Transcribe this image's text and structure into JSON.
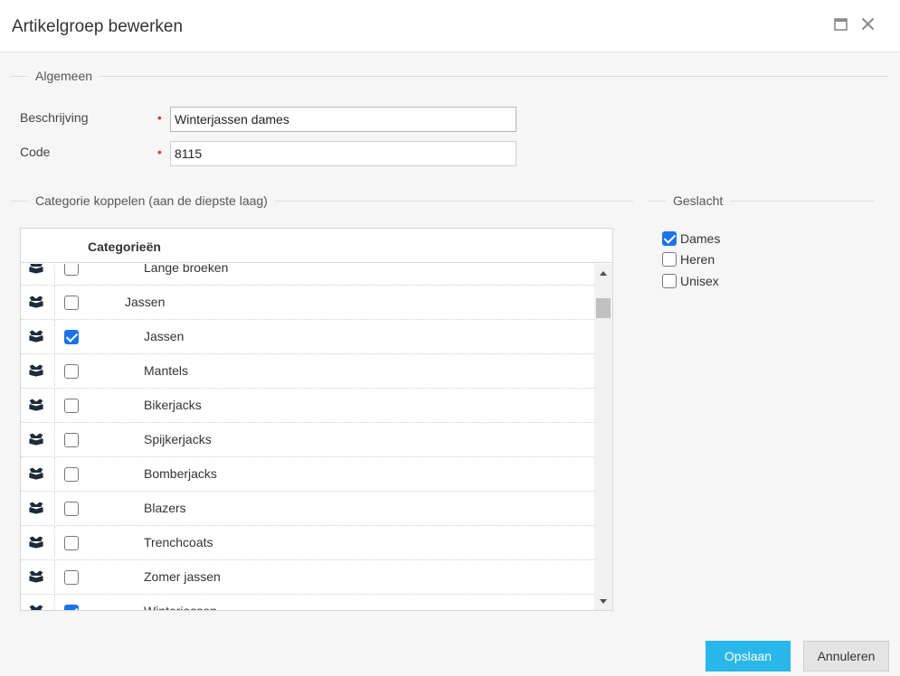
{
  "dialog": {
    "title": "Artikelgroep bewerken",
    "maximize_icon": "maximize-icon",
    "close_icon": "close-icon"
  },
  "general": {
    "legend": "Algemeen",
    "description_label": "Beschrijving",
    "description_value": "Winterjassen dames",
    "code_label": "Code",
    "code_value": "8115",
    "required_marker": "•"
  },
  "category": {
    "legend": "Categorie koppelen (aan de diepste laag)",
    "column_header": "Categorieën",
    "row_icon": "package-icon",
    "rows": [
      {
        "label": "Lange broeken",
        "level": 2,
        "checked": false
      },
      {
        "label": "Jassen",
        "level": 1,
        "checked": false
      },
      {
        "label": "Jassen",
        "level": 2,
        "checked": true
      },
      {
        "label": "Mantels",
        "level": 2,
        "checked": false
      },
      {
        "label": "Bikerjacks",
        "level": 2,
        "checked": false
      },
      {
        "label": "Spijkerjacks",
        "level": 2,
        "checked": false
      },
      {
        "label": "Bomberjacks",
        "level": 2,
        "checked": false
      },
      {
        "label": "Blazers",
        "level": 2,
        "checked": false
      },
      {
        "label": "Trenchcoats",
        "level": 2,
        "checked": false
      },
      {
        "label": "Zomer jassen",
        "level": 2,
        "checked": false
      },
      {
        "label": "Winterjassen",
        "level": 2,
        "checked": true
      }
    ]
  },
  "gender": {
    "legend": "Geslacht",
    "options": [
      {
        "label": "Dames",
        "checked": true
      },
      {
        "label": "Heren",
        "checked": false
      },
      {
        "label": "Unisex",
        "checked": false
      }
    ]
  },
  "actions": {
    "save_label": "Opslaan",
    "cancel_label": "Annuleren"
  },
  "colors": {
    "accent": "#29b6e8",
    "checkbox": "#1a73e8",
    "required": "#e0352b"
  }
}
